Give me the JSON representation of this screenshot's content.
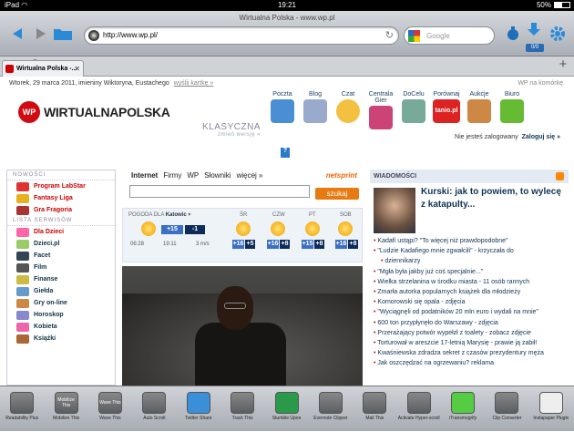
{
  "status": {
    "time": "19:21",
    "battery": "50%"
  },
  "window_title": "Wirtualna Polska - www.wp.pl",
  "url": "http://www.wp.pl/",
  "search_placeholder": "Google",
  "counter": "0/0",
  "tab": {
    "label": "Wirtualna Polska -..."
  },
  "page": {
    "date_line": "Wtorek, 29 marca 2011, imieniny Wiktoryna, Eustachego",
    "send_card": "wyślij kartkę »",
    "mobile": "WP na komórkę",
    "logo_text": "WIRTUALNAPOLSKA",
    "logo_circle": "WP",
    "klasyczna": "KLASYCZNA",
    "zmien": "zmień wersję »",
    "services": [
      "Poczta",
      "Blog",
      "Czat",
      "Centrala Gier",
      "DoCelu",
      "Porównaj",
      "Aukcje",
      "Biuro"
    ],
    "tanio": "tanio.pl",
    "not_logged": "Nie jesteś zalogowany",
    "login": "Zaloguj się »",
    "nowosci_head": "NOWOŚCI",
    "nowosci": [
      "Program LabStar",
      "Fantasy Liga",
      "Gra Fragoria"
    ],
    "lista_head": "LISTA SERWISÓW",
    "lista": [
      "Dla Dzieci",
      "Dzieci.pl",
      "Facet",
      "Film",
      "Finanse",
      "Giełda",
      "Gry on-line",
      "Horoskop",
      "Kobieta",
      "Książki"
    ],
    "search_tabs": [
      "Internet",
      "Firmy",
      "WP",
      "Słowniki",
      "więcej »"
    ],
    "netsprint": "netsprint",
    "szukaj": "szukaj",
    "pogoda": "POGODA DLA",
    "city": "Katowic",
    "wx_today": [
      "+15",
      "-1"
    ],
    "wx_times": [
      "06:28",
      "19:11",
      "3 m/s"
    ],
    "wx_days": [
      "ŚR",
      "CZW",
      "PT",
      "SOB"
    ],
    "wx_day_temps": [
      [
        "+16",
        "+5"
      ],
      [
        "+16",
        "+8"
      ],
      [
        "+15",
        "+8"
      ],
      [
        "+16",
        "+8"
      ]
    ],
    "wiadomosci": "WIADOMOŚCI",
    "top_news": "Kurski: jak to powiem, to wylecę z katapulty...",
    "news": [
      "Kadafi ustąpi? \"To więcej niż prawdopodobne\"",
      "\"Ludzie Kadafiego mnie zgwałcili\" - krzyczała do",
      "dziennikarzy",
      "\"Mgła była jakby już coś specjalnie...\"",
      "Wielka strzelanina w środku miasta - 11 osób rannych",
      "Zmarła autorka popularnych książek dla młodzieży",
      "Komorowski się opala - zdjęcia",
      "\"Wyciągnęli od podatników 20 mln euro i wydali na mnie\"",
      "600 ton przypłynęło do Warszawy - zdjęcia",
      "Przerażający potwór wypełzł z toalety - zobacz zdjęcie",
      "Torturował w areszcie 17-letnią Marysię - prawie ją zabił!",
      "Kwaśniewska zdradza sekret z czasów prezydentury męża",
      "Jak oszczędzać na ogrzewaniu? reklama"
    ]
  },
  "bottom": [
    {
      "icon": "",
      "label": "Readability Plus"
    },
    {
      "icon": "Mobilize This",
      "label": "Mobilize This"
    },
    {
      "icon": "Wave This",
      "label": "Wave This"
    },
    {
      "icon": "",
      "label": "Auto Scroll"
    },
    {
      "icon": "",
      "label": "Twitter Share"
    },
    {
      "icon": "",
      "label": "Track This"
    },
    {
      "icon": "",
      "label": "Stumble Upon"
    },
    {
      "icon": "",
      "label": "Evernote Clipper"
    },
    {
      "icon": "",
      "label": "Mail This"
    },
    {
      "icon": "",
      "label": "Activate Hyper-scroll"
    },
    {
      "icon": "",
      "label": "iTransmogrify"
    },
    {
      "icon": "",
      "label": "Clip Converter"
    },
    {
      "icon": "",
      "label": "Instapaper Plugin"
    }
  ]
}
